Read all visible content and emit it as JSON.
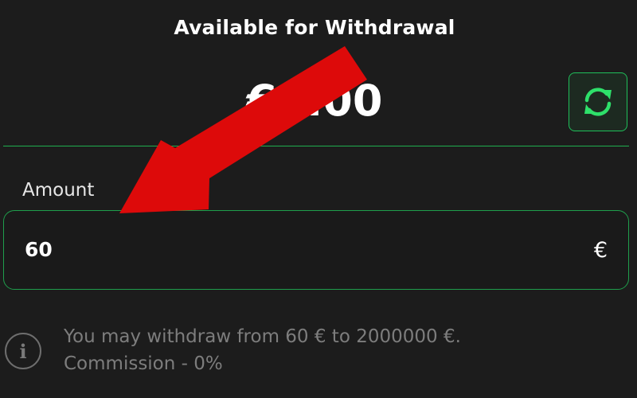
{
  "header": {
    "title": "Available for Withdrawal"
  },
  "balance": {
    "amount": "€0.00"
  },
  "amount_field": {
    "label": "Amount",
    "value": "60",
    "currency_symbol": "€"
  },
  "info": {
    "line1": "You may withdraw from 60 € to 2000000 €.",
    "line2": "Commission - 0%",
    "icon_glyph": "i"
  },
  "icons": {
    "refresh": "refresh-icon",
    "info": "info-icon"
  },
  "colors": {
    "background": "#1c1c1c",
    "accent_green": "#1fbf5a",
    "annotation_red": "#dd0a0a"
  }
}
